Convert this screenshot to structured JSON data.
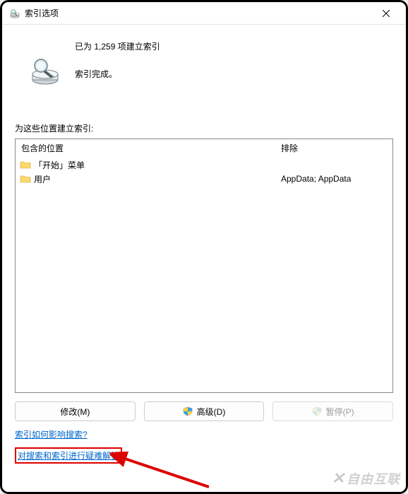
{
  "titlebar": {
    "title": "索引选项"
  },
  "status": {
    "line1": "已为 1,259 项建立索引",
    "line2": "索引完成。"
  },
  "locations": {
    "section_label": "为这些位置建立索引:",
    "header_included": "包含的位置",
    "header_excluded": "排除",
    "included_items": [
      {
        "label": "「开始」菜单"
      },
      {
        "label": "用户"
      }
    ],
    "excluded_items": [
      "",
      "AppData; AppData"
    ]
  },
  "buttons": {
    "modify": "修改(M)",
    "advanced": "高级(D)",
    "pause": "暂停(P)"
  },
  "links": {
    "help": "索引如何影响搜索?",
    "troubleshoot": "对搜索和索引进行疑难解答"
  },
  "watermark": {
    "text": "自由互联"
  }
}
